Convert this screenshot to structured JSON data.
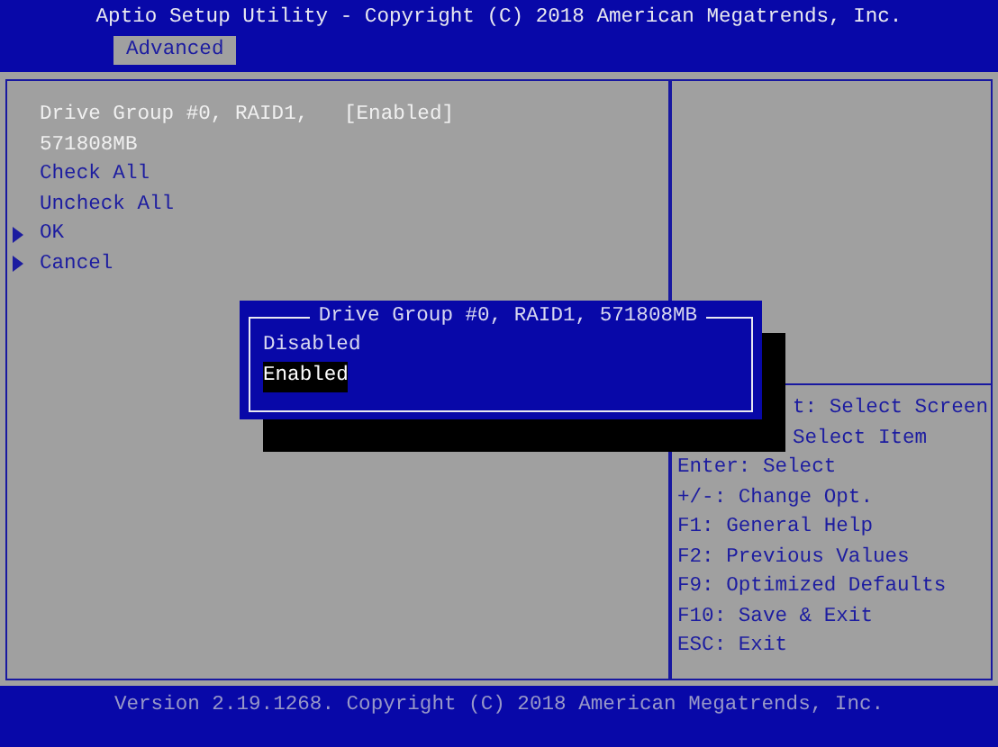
{
  "title": "Aptio Setup Utility - Copyright (C) 2018 American Megatrends, Inc.",
  "tabs": [
    {
      "label": "Advanced",
      "selected": true
    }
  ],
  "items": [
    {
      "kind": "setting",
      "label": "Drive Group #0, RAID1, 571808MB",
      "value": "[Enabled]"
    },
    {
      "kind": "action",
      "label": "Check All"
    },
    {
      "kind": "action",
      "label": "Uncheck All"
    },
    {
      "kind": "submenu",
      "label": "OK"
    },
    {
      "kind": "submenu",
      "label": "Cancel"
    }
  ],
  "help_keys": [
    "t: Select Screen",
    "Select Item",
    "Enter: Select",
    "+/-: Change Opt.",
    "F1: General Help",
    "F2: Previous Values",
    "F9: Optimized Defaults",
    "F10: Save & Exit",
    "ESC: Exit"
  ],
  "popup": {
    "title": "Drive Group #0, RAID1, 571808MB",
    "options": [
      {
        "label": "Disabled",
        "selected": false
      },
      {
        "label": "Enabled",
        "selected": true
      }
    ]
  },
  "footer": "Version 2.19.1268. Copyright (C) 2018 American Megatrends, Inc."
}
